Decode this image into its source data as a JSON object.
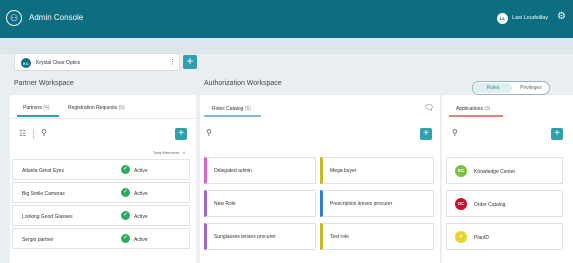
{
  "topbar": {
    "title": "Admin Console",
    "user_initials": "LL",
    "user_name": "Lasi Loudsillay"
  },
  "org": {
    "initials": "KC",
    "name": "Krystal Clear Optics"
  },
  "partner_workspace": {
    "title": "Partner Workspace",
    "tabs": [
      {
        "label": "Partners",
        "count": "(4)"
      },
      {
        "label": "Registration Requests",
        "count": "(0)"
      }
    ],
    "total_members": "Total Members : 4",
    "partners": [
      {
        "name": "Atlanta Great Eyes",
        "status": "Active"
      },
      {
        "name": "Big Smile Cameras",
        "status": "Active"
      },
      {
        "name": "Looking Good Glasses",
        "status": "Active"
      },
      {
        "name": "Sergio partner",
        "status": "Active"
      }
    ]
  },
  "authorization_workspace": {
    "title": "Authorization Workspace",
    "toggle": {
      "roles": "Roles",
      "privileges": "Privileges"
    },
    "roles_catalog": {
      "label": "Roles Catalog",
      "count": "(6)"
    },
    "roles": [
      {
        "label": "Delegated admin",
        "color": "#d866c3"
      },
      {
        "label": "Mega buyer",
        "color": "#c9b81f"
      },
      {
        "label": "New Role",
        "color": "#9a66cc"
      },
      {
        "label": "Prescription lenses procurer",
        "color": "#2f7fd6"
      },
      {
        "label": "Sunglasses lenses procurer",
        "color": "#9a66cc"
      },
      {
        "label": "Test role",
        "color": "#c9b81f"
      }
    ],
    "applications": {
      "label": "Applications",
      "count": "(3)",
      "items": [
        {
          "initials": "KC",
          "label": "Knowledge Center",
          "color": "#7ac143"
        },
        {
          "initials": "OC",
          "label": "Order Catalog",
          "color": "#c8102e"
        },
        {
          "initials": "P",
          "label": "PlanID",
          "color": "#e8d32a"
        }
      ]
    }
  },
  "colors": {
    "brand": "#0c6e80",
    "accent": "#30a0ac",
    "active": "#2dab5f"
  }
}
